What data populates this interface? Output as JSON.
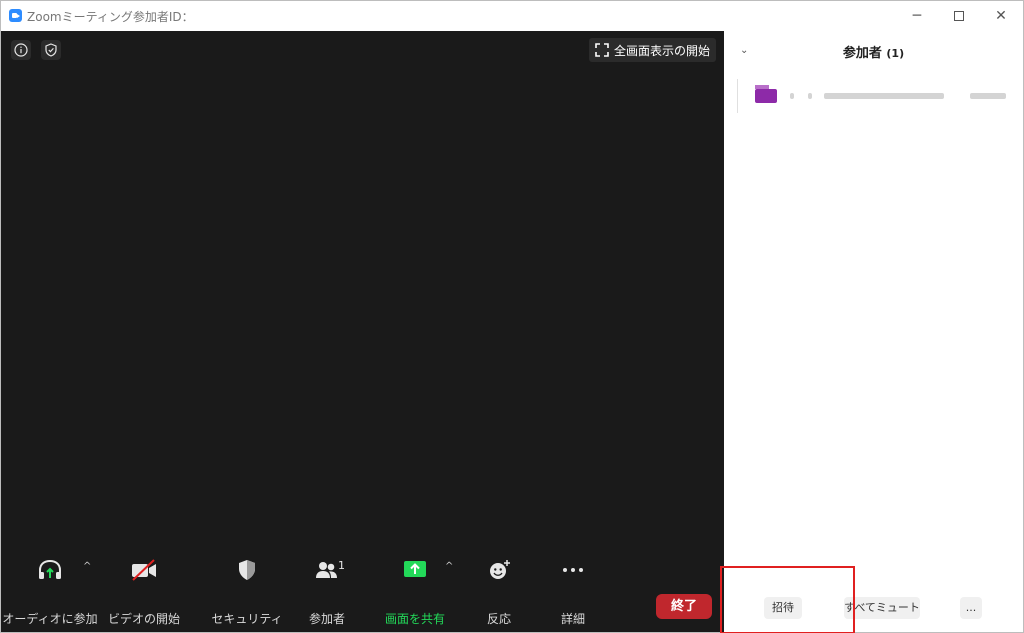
{
  "window": {
    "title": "Zoomミーティング参加者ID：",
    "minimize_glyph": "─",
    "close_glyph": "✕"
  },
  "video": {
    "fullscreen_label": "全画面表示の開始"
  },
  "toolbar": {
    "audio_label": "オーディオに参加",
    "video_label": "ビデオの開始",
    "security_label": "セキュリティ",
    "participants_label": "参加者",
    "participants_count": "1",
    "share_label": "画面を共有",
    "reactions_label": "反応",
    "more_label": "詳細",
    "end_label": "終了",
    "caret": "^"
  },
  "panel": {
    "title": "参加者",
    "count": "(1)",
    "collapse_glyph": "⌄",
    "invite_label": "招待",
    "mute_all_label": "すべてミュート",
    "more_label": "..."
  },
  "colors": {
    "video_bg": "#1a1a1a",
    "share_green": "#23d959",
    "end_red": "#c0272d",
    "highlight_red": "#e02020",
    "zoom_blue": "#2d8cff",
    "avatar_purple": "#8d2aa8"
  },
  "icons": {
    "app": "zoom-logo-icon",
    "info": "info-icon",
    "shield": "shield-icon",
    "fullscreen": "fullscreen-icon",
    "audio": "headphone-icon",
    "video": "video-off-icon",
    "security": "shield-icon",
    "participants": "people-icon",
    "share": "share-screen-icon",
    "reactions": "emoji-icon",
    "more": "ellipsis-icon"
  }
}
